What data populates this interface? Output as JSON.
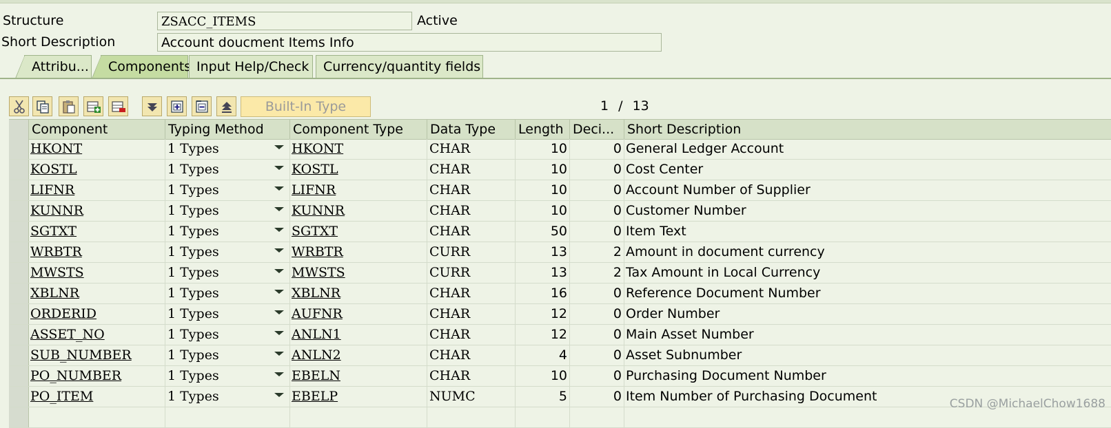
{
  "header": {
    "structure_label": "Structure",
    "structure_value": "ZSACC_ITEMS",
    "status": "Active",
    "short_desc_label": "Short Description",
    "short_desc_value": "Account doucment Items Info"
  },
  "tabs": [
    {
      "label": "Attribu..."
    },
    {
      "label": "Components",
      "active": true
    },
    {
      "label": "Input Help/Check"
    },
    {
      "label": "Currency/quantity fields"
    }
  ],
  "toolbar": {
    "icons": [
      "cut-icon",
      "copy-icon",
      "paste-icon",
      "insert-row-icon",
      "delete-row-icon",
      "first-page-icon",
      "insert-include-icon",
      "expand-icon",
      "last-page-icon"
    ],
    "builtin_type_label": "Built-In Type",
    "pager": {
      "current": "1",
      "separator": "/",
      "total": "13"
    }
  },
  "table": {
    "columns": [
      "Component",
      "Typing Method",
      "Component Type",
      "Data Type",
      "Length",
      "Deci...",
      "Short Description"
    ],
    "rows": [
      {
        "component": "HKONT",
        "typing": "1 Types",
        "comp_type": "HKONT",
        "data_type": "CHAR",
        "length": "10",
        "decimals": "0",
        "desc": "General Ledger Account"
      },
      {
        "component": "KOSTL",
        "typing": "1 Types",
        "comp_type": "KOSTL",
        "data_type": "CHAR",
        "length": "10",
        "decimals": "0",
        "desc": "Cost Center"
      },
      {
        "component": "LIFNR",
        "typing": "1 Types",
        "comp_type": "LIFNR",
        "data_type": "CHAR",
        "length": "10",
        "decimals": "0",
        "desc": "Account Number of Supplier"
      },
      {
        "component": "KUNNR",
        "typing": "1 Types",
        "comp_type": "KUNNR",
        "data_type": "CHAR",
        "length": "10",
        "decimals": "0",
        "desc": "Customer Number"
      },
      {
        "component": "SGTXT",
        "typing": "1 Types",
        "comp_type": "SGTXT",
        "data_type": "CHAR",
        "length": "50",
        "decimals": "0",
        "desc": "Item Text"
      },
      {
        "component": "WRBTR",
        "typing": "1 Types",
        "comp_type": "WRBTR",
        "data_type": "CURR",
        "length": "13",
        "decimals": "2",
        "desc": "Amount in document currency"
      },
      {
        "component": "MWSTS",
        "typing": "1 Types",
        "comp_type": "MWSTS",
        "data_type": "CURR",
        "length": "13",
        "decimals": "2",
        "desc": "Tax Amount in Local Currency"
      },
      {
        "component": "XBLNR",
        "typing": "1 Types",
        "comp_type": "XBLNR",
        "data_type": "CHAR",
        "length": "16",
        "decimals": "0",
        "desc": "Reference Document Number"
      },
      {
        "component": "ORDERID",
        "typing": "1 Types",
        "comp_type": "AUFNR",
        "data_type": "CHAR",
        "length": "12",
        "decimals": "0",
        "desc": "Order Number"
      },
      {
        "component": "ASSET_NO",
        "typing": "1 Types",
        "comp_type": "ANLN1",
        "data_type": "CHAR",
        "length": "12",
        "decimals": "0",
        "desc": "Main Asset Number"
      },
      {
        "component": "SUB_NUMBER",
        "typing": "1 Types",
        "comp_type": "ANLN2",
        "data_type": "CHAR",
        "length": "4",
        "decimals": "0",
        "desc": "Asset Subnumber"
      },
      {
        "component": "PO_NUMBER",
        "typing": "1 Types",
        "comp_type": "EBELN",
        "data_type": "CHAR",
        "length": "10",
        "decimals": "0",
        "desc": "Purchasing Document Number"
      },
      {
        "component": "PO_ITEM",
        "typing": "1 Types",
        "comp_type": "EBELP",
        "data_type": "NUMC",
        "length": "5",
        "decimals": "0",
        "desc": "Item Number of Purchasing Document"
      },
      {
        "component": "",
        "typing": "",
        "comp_type": "",
        "data_type": "",
        "length": "",
        "decimals": "",
        "desc": ""
      }
    ]
  },
  "watermark": "CSDN @MichaelChow1688",
  "colors": {
    "background": "#eef3e6",
    "tab_active": "#c5dca2",
    "toolbar_button": "#f2e6b0"
  }
}
